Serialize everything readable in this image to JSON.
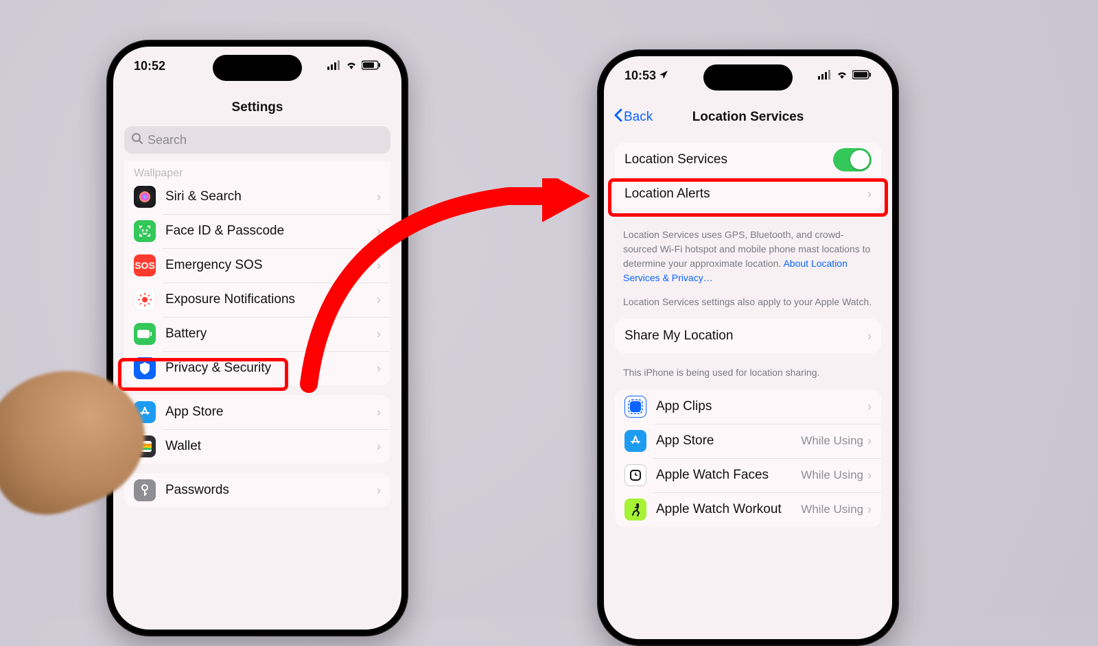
{
  "left_phone": {
    "time": "10:52",
    "title": "Settings",
    "search_placeholder": "Search",
    "cut_item": "Wallpaper",
    "items_group1": [
      {
        "label": "Siri & Search",
        "icon": "siri"
      },
      {
        "label": "Face ID & Passcode",
        "icon": "faceid"
      },
      {
        "label": "Emergency SOS",
        "icon": "sos",
        "icon_text": "SOS"
      },
      {
        "label": "Exposure Notifications",
        "icon": "exposure"
      },
      {
        "label": "Battery",
        "icon": "battery"
      },
      {
        "label": "Privacy & Security",
        "icon": "privacy",
        "highlighted": true
      }
    ],
    "items_group2": [
      {
        "label": "App Store",
        "icon": "appstore"
      },
      {
        "label": "Wallet",
        "icon": "wallet"
      }
    ],
    "items_group3": [
      {
        "label": "Passwords",
        "icon": "passwords"
      }
    ]
  },
  "right_phone": {
    "time": "10:53",
    "back": "Back",
    "title": "Location Services",
    "toggle_row": {
      "label": "Location Services",
      "on": true,
      "highlighted": true
    },
    "alerts_row": {
      "label": "Location Alerts"
    },
    "description1": "Location Services uses GPS, Bluetooth, and crowd-sourced Wi-Fi hotspot and mobile phone mast locations to determine your approximate location. ",
    "description_link": "About Location Services & Privacy…",
    "description2": "Location Services settings also apply to your Apple Watch.",
    "share_row": {
      "label": "Share My Location"
    },
    "share_footer": "This iPhone is being used for location sharing.",
    "apps": [
      {
        "label": "App Clips",
        "detail": "",
        "icon": "appclips"
      },
      {
        "label": "App Store",
        "detail": "While Using",
        "icon": "appstore"
      },
      {
        "label": "Apple Watch Faces",
        "detail": "While Using",
        "icon": "watchfaces"
      },
      {
        "label": "Apple Watch Workout",
        "detail": "While Using",
        "icon": "workout"
      }
    ]
  }
}
